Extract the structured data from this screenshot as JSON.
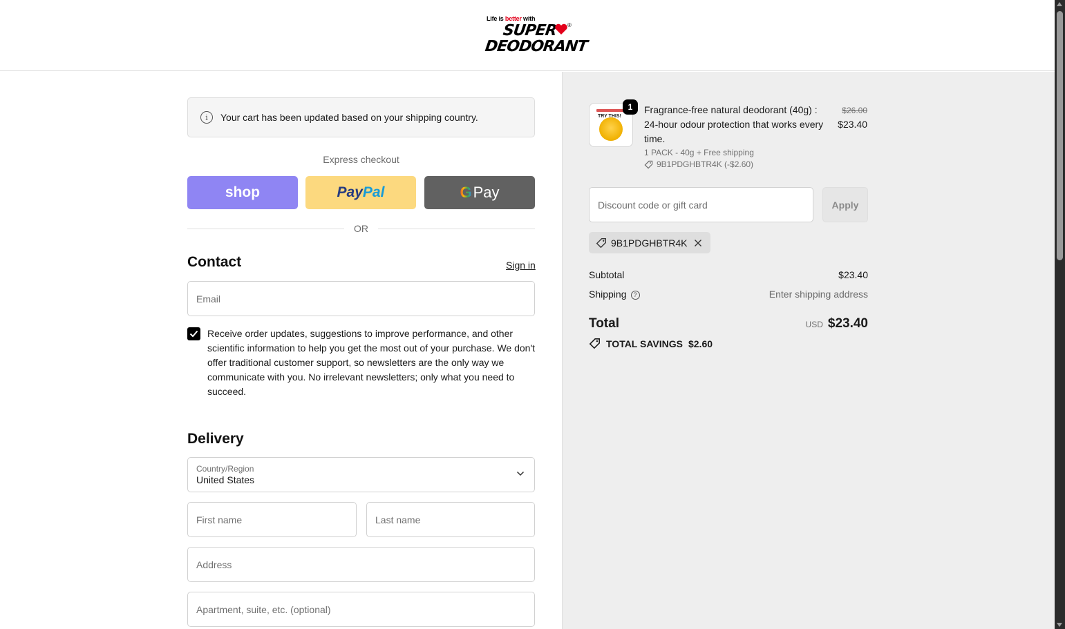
{
  "brand": {
    "tagline_prefix": "Life is",
    "tagline_emphasis": "better",
    "tagline_suffix": "with",
    "name_line1": "SUPER",
    "name_line2": "DEODORANT",
    "registered": "®",
    "accent_color": "#e3001b"
  },
  "notice": {
    "icon": "info-icon",
    "text": "Your cart has been updated based on your shipping country."
  },
  "express": {
    "label": "Express checkout",
    "shop_label": "shop",
    "paypal_part1": "Pay",
    "paypal_part2": "Pal",
    "gpay_g": "G",
    "gpay_label": "Pay",
    "separator": "OR"
  },
  "contact": {
    "title": "Contact",
    "signin": "Sign in",
    "email_placeholder": "Email",
    "newsletter_checked": true,
    "newsletter_text": "Receive order updates, suggestions to improve performance, and other scientific information to help you get the most out of your purchase. We don't offer traditional customer support, so newsletters are the only way we communicate with you. No irrelevant newsletters; only what you need to succeed."
  },
  "delivery": {
    "title": "Delivery",
    "country_label": "Country/Region",
    "country_value": "United States",
    "first_name_placeholder": "First name",
    "last_name_placeholder": "Last name",
    "address_placeholder": "Address",
    "apartment_placeholder": "Apartment, suite, etc. (optional)"
  },
  "summary": {
    "item": {
      "quantity": "1",
      "title": "Fragrance-free natural deodorant (40g) : 24-hour odour protection that works every time.",
      "variant": "1 PACK - 40g + Free shipping",
      "discount": "9B1PDGHBTR4K (-$2.60)",
      "price_original": "$26.00",
      "price_current": "$23.40",
      "image_text": "TRY THIS!"
    },
    "discount_placeholder": "Discount code or gift card",
    "apply_label": "Apply",
    "applied_code": "9B1PDGHBTR4K",
    "subtotal_label": "Subtotal",
    "subtotal_value": "$23.40",
    "shipping_label": "Shipping",
    "shipping_value": "Enter shipping address",
    "total_label": "Total",
    "total_currency": "USD",
    "total_value": "$23.40",
    "savings_label": "TOTAL SAVINGS",
    "savings_value": "$2.60"
  }
}
